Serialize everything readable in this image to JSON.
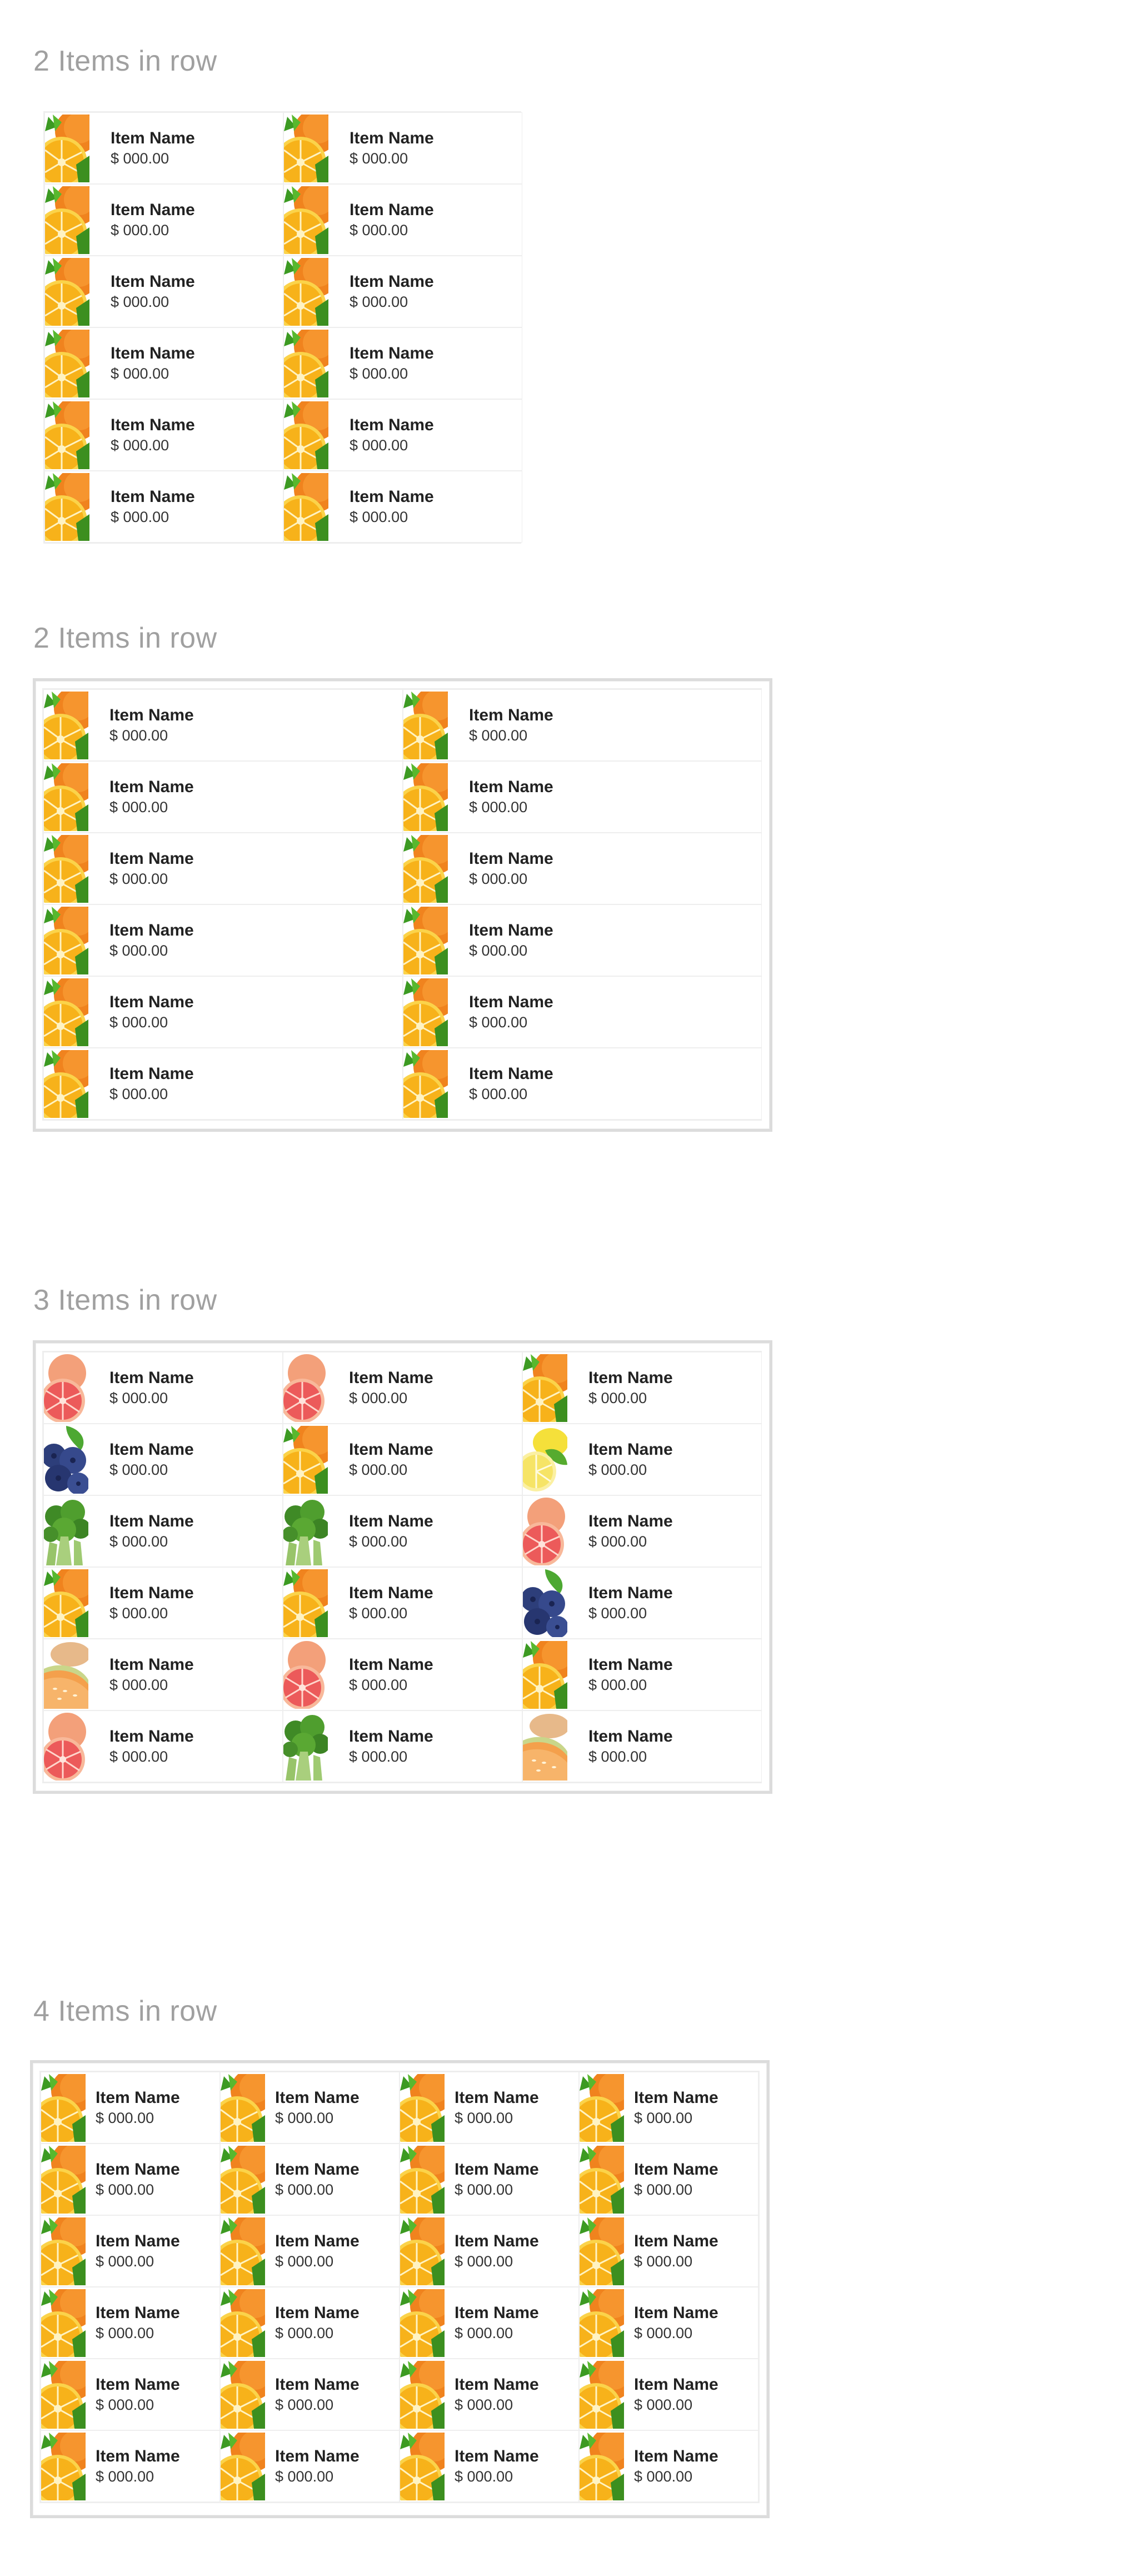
{
  "sections": [
    {
      "title": "2 Items in row",
      "columns": 2,
      "framed": false,
      "items": [
        {
          "name": "Item Name",
          "price": "$ 000.00",
          "image": "orange"
        },
        {
          "name": "Item Name",
          "price": "$ 000.00",
          "image": "orange"
        },
        {
          "name": "Item Name",
          "price": "$ 000.00",
          "image": "orange"
        },
        {
          "name": "Item Name",
          "price": "$ 000.00",
          "image": "orange"
        },
        {
          "name": "Item Name",
          "price": "$ 000.00",
          "image": "orange"
        },
        {
          "name": "Item Name",
          "price": "$ 000.00",
          "image": "orange"
        },
        {
          "name": "Item Name",
          "price": "$ 000.00",
          "image": "orange"
        },
        {
          "name": "Item Name",
          "price": "$ 000.00",
          "image": "orange"
        },
        {
          "name": "Item Name",
          "price": "$ 000.00",
          "image": "orange"
        },
        {
          "name": "Item Name",
          "price": "$ 000.00",
          "image": "orange"
        },
        {
          "name": "Item Name",
          "price": "$ 000.00",
          "image": "orange"
        },
        {
          "name": "Item Name",
          "price": "$ 000.00",
          "image": "orange"
        }
      ]
    },
    {
      "title": "2 Items in row",
      "columns": 2,
      "framed": true,
      "items": [
        {
          "name": "Item Name",
          "price": "$ 000.00",
          "image": "orange"
        },
        {
          "name": "Item Name",
          "price": "$ 000.00",
          "image": "orange"
        },
        {
          "name": "Item Name",
          "price": "$ 000.00",
          "image": "orange"
        },
        {
          "name": "Item Name",
          "price": "$ 000.00",
          "image": "orange"
        },
        {
          "name": "Item Name",
          "price": "$ 000.00",
          "image": "orange"
        },
        {
          "name": "Item Name",
          "price": "$ 000.00",
          "image": "orange"
        },
        {
          "name": "Item Name",
          "price": "$ 000.00",
          "image": "orange"
        },
        {
          "name": "Item Name",
          "price": "$ 000.00",
          "image": "orange"
        },
        {
          "name": "Item Name",
          "price": "$ 000.00",
          "image": "orange"
        },
        {
          "name": "Item Name",
          "price": "$ 000.00",
          "image": "orange"
        },
        {
          "name": "Item Name",
          "price": "$ 000.00",
          "image": "orange"
        },
        {
          "name": "Item Name",
          "price": "$ 000.00",
          "image": "orange"
        }
      ]
    },
    {
      "title": "3 Items in row",
      "columns": 3,
      "framed": true,
      "items": [
        {
          "name": "Item Name",
          "price": "$ 000.00",
          "image": "grapefruit"
        },
        {
          "name": "Item Name",
          "price": "$ 000.00",
          "image": "grapefruit"
        },
        {
          "name": "Item Name",
          "price": "$ 000.00",
          "image": "orange"
        },
        {
          "name": "Item Name",
          "price": "$ 000.00",
          "image": "blueberry"
        },
        {
          "name": "Item Name",
          "price": "$ 000.00",
          "image": "orange"
        },
        {
          "name": "Item Name",
          "price": "$ 000.00",
          "image": "lemon"
        },
        {
          "name": "Item Name",
          "price": "$ 000.00",
          "image": "broccoli"
        },
        {
          "name": "Item Name",
          "price": "$ 000.00",
          "image": "broccoli"
        },
        {
          "name": "Item Name",
          "price": "$ 000.00",
          "image": "grapefruit"
        },
        {
          "name": "Item Name",
          "price": "$ 000.00",
          "image": "orange"
        },
        {
          "name": "Item Name",
          "price": "$ 000.00",
          "image": "orange"
        },
        {
          "name": "Item Name",
          "price": "$ 000.00",
          "image": "blueberry"
        },
        {
          "name": "Item Name",
          "price": "$ 000.00",
          "image": "melon"
        },
        {
          "name": "Item Name",
          "price": "$ 000.00",
          "image": "grapefruit"
        },
        {
          "name": "Item Name",
          "price": "$ 000.00",
          "image": "orange"
        },
        {
          "name": "Item Name",
          "price": "$ 000.00",
          "image": "grapefruit"
        },
        {
          "name": "Item Name",
          "price": "$ 000.00",
          "image": "broccoli"
        },
        {
          "name": "Item Name",
          "price": "$ 000.00",
          "image": "melon"
        }
      ]
    },
    {
      "title": "4 Items in row",
      "columns": 4,
      "framed": true,
      "items": [
        {
          "name": "Item Name",
          "price": "$ 000.00",
          "image": "orange"
        },
        {
          "name": "Item Name",
          "price": "$ 000.00",
          "image": "orange"
        },
        {
          "name": "Item Name",
          "price": "$ 000.00",
          "image": "orange"
        },
        {
          "name": "Item Name",
          "price": "$ 000.00",
          "image": "orange"
        },
        {
          "name": "Item Name",
          "price": "$ 000.00",
          "image": "orange"
        },
        {
          "name": "Item Name",
          "price": "$ 000.00",
          "image": "orange"
        },
        {
          "name": "Item Name",
          "price": "$ 000.00",
          "image": "orange"
        },
        {
          "name": "Item Name",
          "price": "$ 000.00",
          "image": "orange"
        },
        {
          "name": "Item Name",
          "price": "$ 000.00",
          "image": "orange"
        },
        {
          "name": "Item Name",
          "price": "$ 000.00",
          "image": "orange"
        },
        {
          "name": "Item Name",
          "price": "$ 000.00",
          "image": "orange"
        },
        {
          "name": "Item Name",
          "price": "$ 000.00",
          "image": "orange"
        },
        {
          "name": "Item Name",
          "price": "$ 000.00",
          "image": "orange"
        },
        {
          "name": "Item Name",
          "price": "$ 000.00",
          "image": "orange"
        },
        {
          "name": "Item Name",
          "price": "$ 000.00",
          "image": "orange"
        },
        {
          "name": "Item Name",
          "price": "$ 000.00",
          "image": "orange"
        },
        {
          "name": "Item Name",
          "price": "$ 000.00",
          "image": "orange"
        },
        {
          "name": "Item Name",
          "price": "$ 000.00",
          "image": "orange"
        },
        {
          "name": "Item Name",
          "price": "$ 000.00",
          "image": "orange"
        },
        {
          "name": "Item Name",
          "price": "$ 000.00",
          "image": "orange"
        },
        {
          "name": "Item Name",
          "price": "$ 000.00",
          "image": "orange"
        },
        {
          "name": "Item Name",
          "price": "$ 000.00",
          "image": "orange"
        },
        {
          "name": "Item Name",
          "price": "$ 000.00",
          "image": "orange"
        },
        {
          "name": "Item Name",
          "price": "$ 000.00",
          "image": "orange"
        }
      ]
    }
  ]
}
